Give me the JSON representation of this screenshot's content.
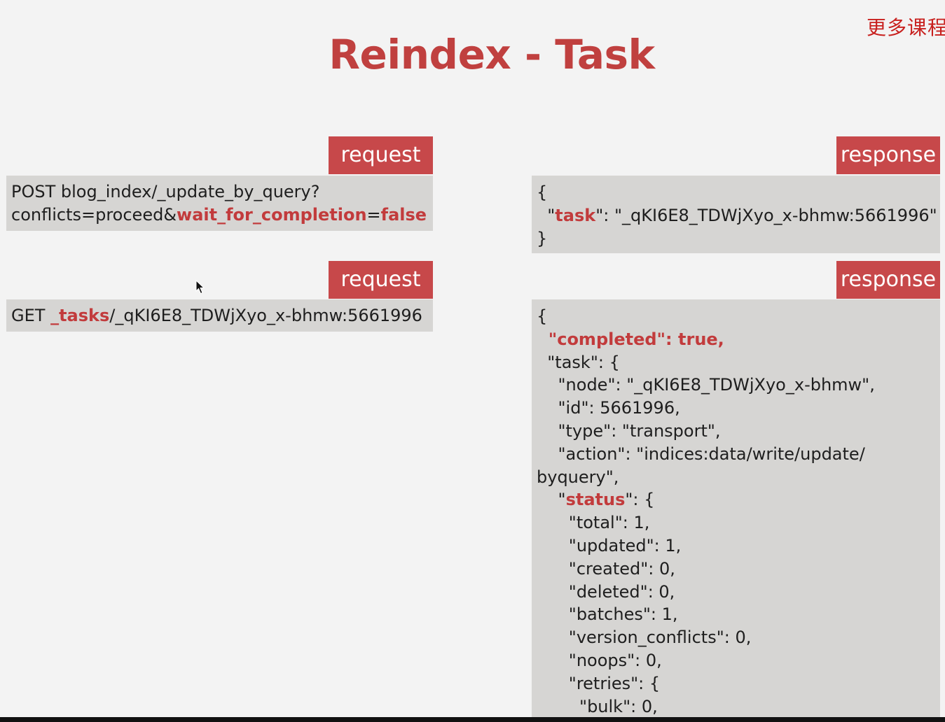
{
  "watermark": "更多课程",
  "title": "Reindex - Task",
  "request1": {
    "label": "request",
    "line1": "POST blog_index/_update_by_query?",
    "line2_a": "conflicts=proceed&",
    "line2_b": "wait_for_completion",
    "line2_c": "=",
    "line2_d": "false"
  },
  "request2": {
    "label": "request",
    "a": "GET ",
    "b": "_tasks",
    "c": "/_qKI6E8_TDWjXyo_x-bhmw:5661996"
  },
  "response1": {
    "label": "response",
    "open": "{",
    "key_a": "  \"",
    "key_b": "task",
    "key_c": "\": \"_qKI6E8_TDWjXyo_x-bhmw:5661996\"",
    "close": "}"
  },
  "response2": {
    "label": "response",
    "l01": "{",
    "l02": "  \"completed\": true,",
    "l03": "  \"task\": {",
    "l04": "    \"node\": \"_qKI6E8_TDWjXyo_x-bhmw\",",
    "l05": "    \"id\": 5661996,",
    "l06": "    \"type\": \"transport\",",
    "l07": "    \"action\": \"indices:data/write/update/",
    "l08": "byquery\",",
    "l09a": "    \"",
    "l09b": "status",
    "l09c": "\": {",
    "l10": "      \"total\": 1,",
    "l11": "      \"updated\": 1,",
    "l12": "      \"created\": 0,",
    "l13": "      \"deleted\": 0,",
    "l14": "      \"batches\": 1,",
    "l15": "      \"version_conflicts\": 0,",
    "l16": "      \"noops\": 0,",
    "l17": "      \"retries\": {",
    "l18": "        \"bulk\": 0,"
  },
  "colors": {
    "accent": "#c7484a",
    "title": "#c0403f",
    "box": "#d6d5d3",
    "background": "#f3f3f3"
  },
  "icons": {
    "cursor": "mouse-pointer-icon"
  }
}
